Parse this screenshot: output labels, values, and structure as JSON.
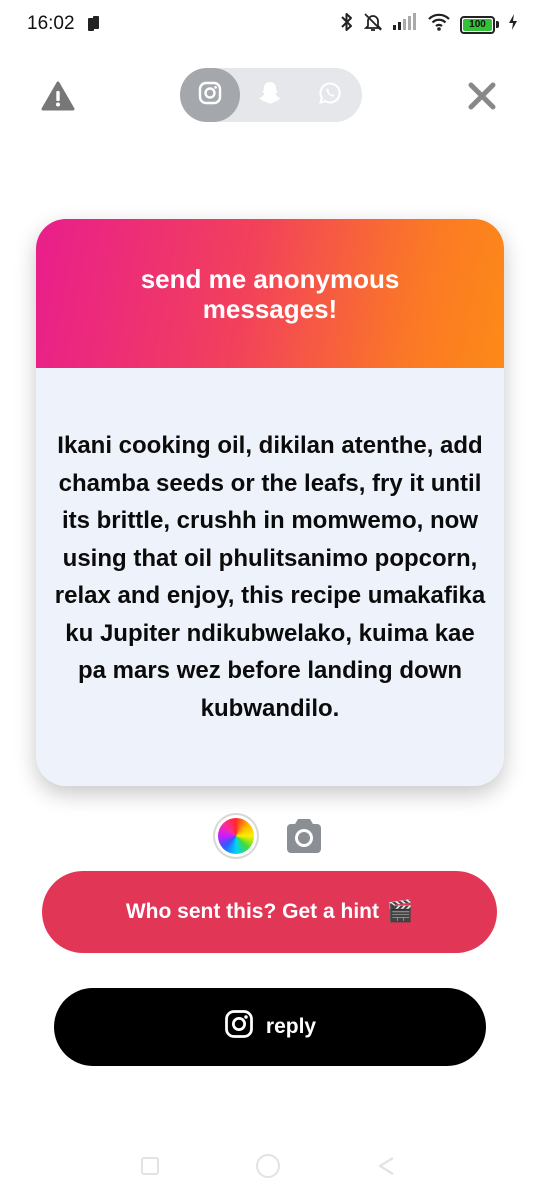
{
  "status_bar": {
    "time": "16:02",
    "battery": "100",
    "icons": [
      "sim-icon",
      "bluetooth-icon",
      "mute-icon",
      "signal-icon",
      "wifi-icon",
      "battery-icon",
      "charging-icon"
    ]
  },
  "top_bar": {
    "left_icon": "warning-icon",
    "right_icon": "close-icon",
    "platforms": [
      {
        "name": "instagram",
        "icon": "instagram-icon",
        "active": true
      },
      {
        "name": "snapchat",
        "icon": "snapchat-icon",
        "active": false
      },
      {
        "name": "whatsapp",
        "icon": "whatsapp-icon",
        "active": false
      }
    ]
  },
  "card": {
    "title": "send me anonymous messages!",
    "message": "Ikani cooking oil, dikilan atenthe, add chamba seeds or the leafs, fry it until its brittle, crushh in momwemo, now using that oil phulitsanimo popcorn, relax and enjoy, this recipe umakafika ku Jupiter ndikubwelako, kuima kae pa mars wez before landing down kubwandilo.",
    "gradient_colors": [
      "#e91e8c",
      "#fd8a17"
    ]
  },
  "tools": {
    "color_picker_icon": "color-wheel-icon",
    "camera_icon": "camera-icon"
  },
  "buttons": {
    "hint_label": "Who sent this? Get a hint",
    "hint_emoji": "🎬",
    "hint_color": "#e23657",
    "reply_label": "reply",
    "reply_color": "#000000"
  },
  "nav_bar": {
    "icons": [
      "recent-apps-icon",
      "home-icon",
      "back-icon"
    ]
  }
}
